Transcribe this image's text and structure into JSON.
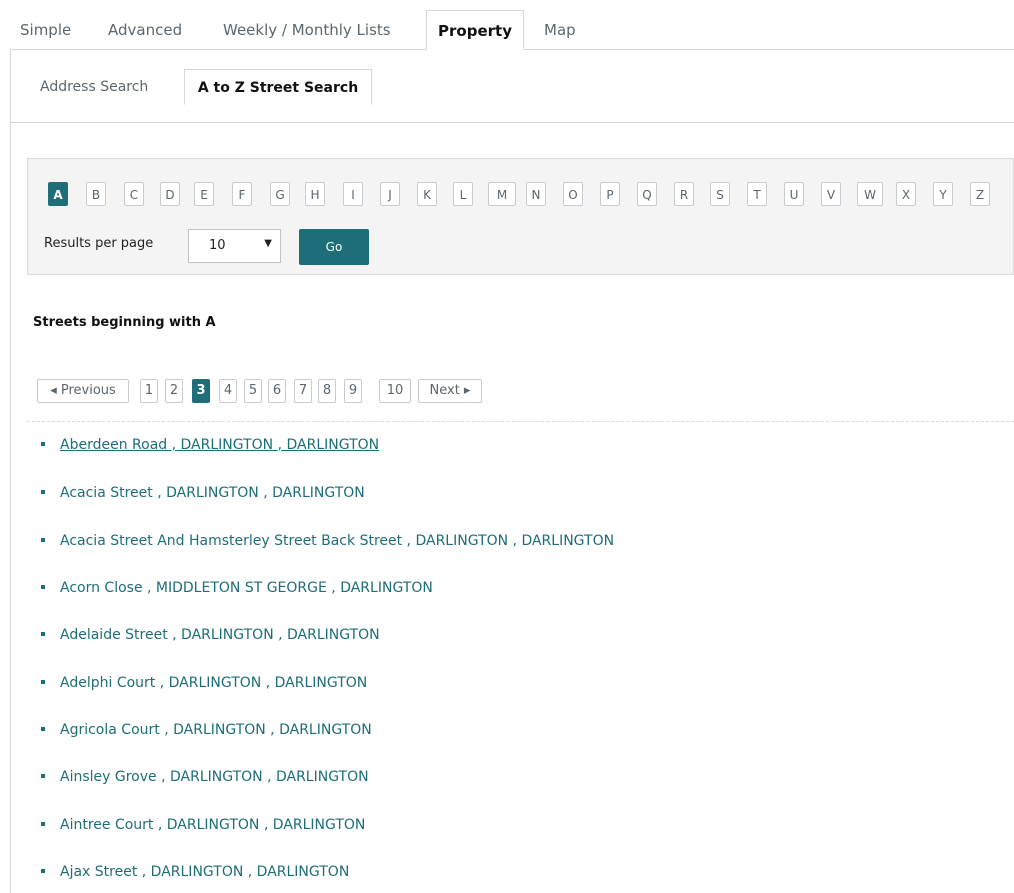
{
  "top_tabs": [
    "Simple",
    "Advanced",
    "Weekly / Monthly Lists",
    "Property",
    "Map"
  ],
  "sub_tabs": [
    "Address Search",
    "A to Z Street Search"
  ],
  "letters": [
    "A",
    "B",
    "C",
    "D",
    "E",
    "F",
    "G",
    "H",
    "I",
    "J",
    "K",
    "L",
    "M",
    "N",
    "O",
    "P",
    "Q",
    "R",
    "S",
    "T",
    "U",
    "V",
    "W",
    "X",
    "Y",
    "Z"
  ],
  "results_per_page": {
    "label": "Results per page",
    "value": "10",
    "caret": "▼"
  },
  "go_label": "Go",
  "results_heading": "Streets beginning with A",
  "pagination": {
    "previous": "◂ Previous",
    "pages": [
      "1",
      "2",
      "3",
      "4",
      "5",
      "6",
      "7",
      "8",
      "9",
      "10"
    ],
    "next": "Next ▸",
    "current": "3"
  },
  "streets": [
    "Aberdeen Road , DARLINGTON , DARLINGTON",
    "Acacia Street , DARLINGTON , DARLINGTON",
    "Acacia Street And Hamsterley Street Back Street , DARLINGTON , DARLINGTON",
    "Acorn Close , MIDDLETON ST GEORGE , DARLINGTON",
    "Adelaide Street , DARLINGTON , DARLINGTON",
    "Adelphi Court , DARLINGTON , DARLINGTON",
    "Agricola Court , DARLINGTON , DARLINGTON",
    "Ainsley Grove , DARLINGTON , DARLINGTON",
    "Aintree Court , DARLINGTON , DARLINGTON",
    "Ajax Street , DARLINGTON , DARLINGTON"
  ],
  "colors": {
    "accent": "#1d6e78",
    "panel_bg": "#f4f4f4",
    "border": "#d6d6d6"
  }
}
